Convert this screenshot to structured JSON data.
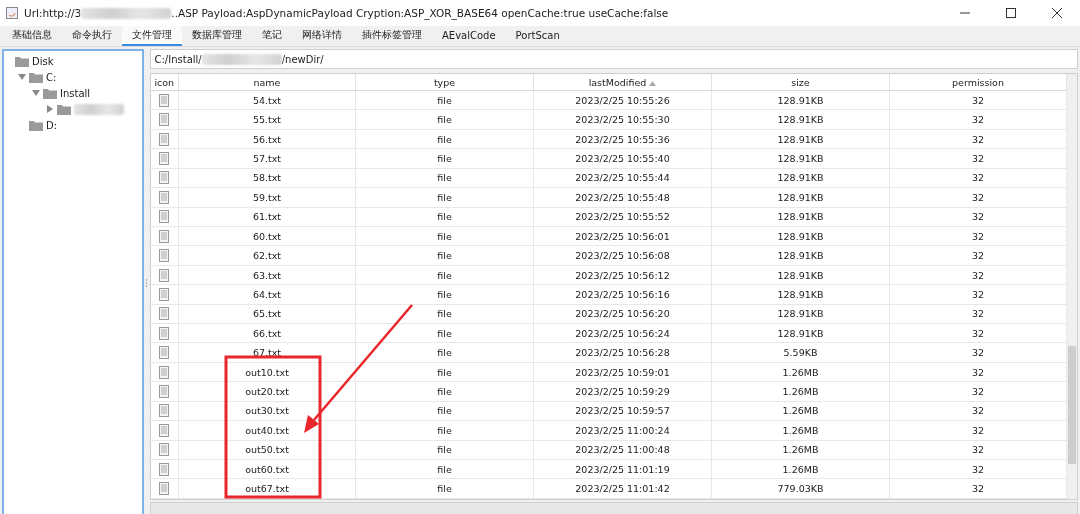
{
  "window": {
    "title_prefix": "Url:http://3",
    "title_suffix": "..ASP Payload:AspDynamicPayload Cryption:ASP_XOR_BASE64 openCache:true useCache:false"
  },
  "tabs": [
    {
      "label": "基础信息",
      "selected": false
    },
    {
      "label": "命令执行",
      "selected": false
    },
    {
      "label": "文件管理",
      "selected": true
    },
    {
      "label": "数据库管理",
      "selected": false
    },
    {
      "label": "笔记",
      "selected": false
    },
    {
      "label": "网络详情",
      "selected": false
    },
    {
      "label": "插件标签管理",
      "selected": false
    },
    {
      "label": "AEvalCode",
      "selected": false
    },
    {
      "label": "PortScan",
      "selected": false
    }
  ],
  "tree": [
    {
      "label": "Disk",
      "children": [
        {
          "label": "C:",
          "expanded": true,
          "children": [
            {
              "label": "Install",
              "expanded": true,
              "children": [
                {
                  "kind": "redacted",
                  "expanded": false
                }
              ]
            }
          ]
        },
        {
          "label": "D:"
        }
      ]
    }
  ],
  "path": {
    "prefix": "C:/Install/",
    "suffix": "/newDir/"
  },
  "table": {
    "columns": [
      {
        "label": "icon"
      },
      {
        "label": "name"
      },
      {
        "label": "type"
      },
      {
        "label": "lastModified",
        "sorted": true
      },
      {
        "label": "size"
      },
      {
        "label": "permission"
      }
    ],
    "rows": [
      {
        "name": "54.txt",
        "type": "file",
        "lastModified": "2023/2/25 10:55:26",
        "size": "128.91KB",
        "permission": "32"
      },
      {
        "name": "55.txt",
        "type": "file",
        "lastModified": "2023/2/25 10:55:30",
        "size": "128.91KB",
        "permission": "32"
      },
      {
        "name": "56.txt",
        "type": "file",
        "lastModified": "2023/2/25 10:55:36",
        "size": "128.91KB",
        "permission": "32"
      },
      {
        "name": "57.txt",
        "type": "file",
        "lastModified": "2023/2/25 10:55:40",
        "size": "128.91KB",
        "permission": "32"
      },
      {
        "name": "58.txt",
        "type": "file",
        "lastModified": "2023/2/25 10:55:44",
        "size": "128.91KB",
        "permission": "32"
      },
      {
        "name": "59.txt",
        "type": "file",
        "lastModified": "2023/2/25 10:55:48",
        "size": "128.91KB",
        "permission": "32"
      },
      {
        "name": "61.txt",
        "type": "file",
        "lastModified": "2023/2/25 10:55:52",
        "size": "128.91KB",
        "permission": "32"
      },
      {
        "name": "60.txt",
        "type": "file",
        "lastModified": "2023/2/25 10:56:01",
        "size": "128.91KB",
        "permission": "32"
      },
      {
        "name": "62.txt",
        "type": "file",
        "lastModified": "2023/2/25 10:56:08",
        "size": "128.91KB",
        "permission": "32"
      },
      {
        "name": "63.txt",
        "type": "file",
        "lastModified": "2023/2/25 10:56:12",
        "size": "128.91KB",
        "permission": "32"
      },
      {
        "name": "64.txt",
        "type": "file",
        "lastModified": "2023/2/25 10:56:16",
        "size": "128.91KB",
        "permission": "32"
      },
      {
        "name": "65.txt",
        "type": "file",
        "lastModified": "2023/2/25 10:56:20",
        "size": "128.91KB",
        "permission": "32"
      },
      {
        "name": "66.txt",
        "type": "file",
        "lastModified": "2023/2/25 10:56:24",
        "size": "128.91KB",
        "permission": "32"
      },
      {
        "name": "67.txt",
        "type": "file",
        "lastModified": "2023/2/25 10:56:28",
        "size": "5.59KB",
        "permission": "32"
      },
      {
        "name": "out10.txt",
        "type": "file",
        "lastModified": "2023/2/25 10:59:01",
        "size": "1.26MB",
        "permission": "32"
      },
      {
        "name": "out20.txt",
        "type": "file",
        "lastModified": "2023/2/25 10:59:29",
        "size": "1.26MB",
        "permission": "32"
      },
      {
        "name": "out30.txt",
        "type": "file",
        "lastModified": "2023/2/25 10:59:57",
        "size": "1.26MB",
        "permission": "32"
      },
      {
        "name": "out40.txt",
        "type": "file",
        "lastModified": "2023/2/25 11:00:24",
        "size": "1.26MB",
        "permission": "32"
      },
      {
        "name": "out50.txt",
        "type": "file",
        "lastModified": "2023/2/25 11:00:48",
        "size": "1.26MB",
        "permission": "32"
      },
      {
        "name": "out60.txt",
        "type": "file",
        "lastModified": "2023/2/25 11:01:19",
        "size": "1.26MB",
        "permission": "32"
      },
      {
        "name": "out67.txt",
        "type": "file",
        "lastModified": "2023/2/25 11:01:42",
        "size": "779.03KB",
        "permission": "32"
      }
    ]
  }
}
